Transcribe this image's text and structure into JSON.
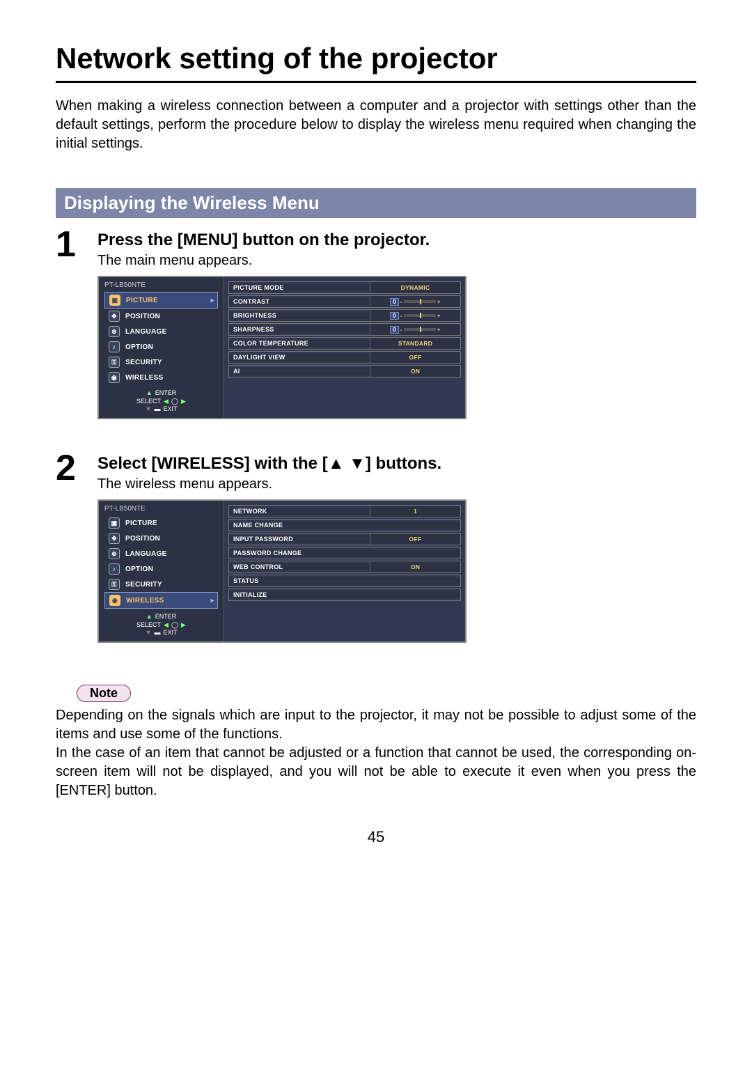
{
  "title": "Network setting of the projector",
  "intro": "When making a wireless connection between a computer and a projector with settings other than the default settings, perform the procedure below to display the wireless menu required when changing the initial settings.",
  "section_heading": "Displaying the Wireless Menu",
  "steps": [
    {
      "num": "1",
      "title": "Press the [MENU] button on the projector.",
      "desc": "The main menu appears."
    },
    {
      "num": "2",
      "title": "Select [WIRELESS] with the [▲ ▼] buttons.",
      "desc": "The wireless menu appears."
    }
  ],
  "osd": {
    "model": "PT-LB50NTE",
    "left_items": [
      "PICTURE",
      "POSITION",
      "LANGUAGE",
      "OPTION",
      "SECURITY",
      "WIRELESS"
    ],
    "controls": {
      "select": "SELECT",
      "enter": "ENTER",
      "exit": "EXIT"
    }
  },
  "osd1": {
    "selected": "PICTURE",
    "rows": [
      {
        "label": "PICTURE MODE",
        "value": "DYNAMIC",
        "type": "text"
      },
      {
        "label": "CONTRAST",
        "value": "0",
        "type": "slider"
      },
      {
        "label": "BRIGHTNESS",
        "value": "0",
        "type": "slider"
      },
      {
        "label": "SHARPNESS",
        "value": "0",
        "type": "slider"
      },
      {
        "label": "COLOR TEMPERATURE",
        "value": "STANDARD",
        "type": "text"
      },
      {
        "label": "DAYLIGHT VIEW",
        "value": "OFF",
        "type": "text"
      },
      {
        "label": "AI",
        "value": "ON",
        "type": "text"
      }
    ]
  },
  "osd2": {
    "selected": "WIRELESS",
    "rows": [
      {
        "label": "NETWORK",
        "value": "1",
        "type": "text"
      },
      {
        "label": "NAME CHANGE",
        "value": "",
        "type": "single"
      },
      {
        "label": "INPUT PASSWORD",
        "value": "OFF",
        "type": "text"
      },
      {
        "label": "PASSWORD CHANGE",
        "value": "",
        "type": "single"
      },
      {
        "label": "WEB CONTROL",
        "value": "ON",
        "type": "text"
      },
      {
        "label": "STATUS",
        "value": "",
        "type": "single"
      },
      {
        "label": "INITIALIZE",
        "value": "",
        "type": "single"
      }
    ]
  },
  "note": {
    "label": "Note",
    "text1": "Depending on the signals which are input to the projector, it may not be possible to adjust some of the items and use some of the functions.",
    "text2": "In the case of an item that cannot be adjusted or a function that cannot be used, the corresponding on-screen item will not be displayed, and you will not be able to execute it even when you press the [ENTER] button."
  },
  "page_number": "45"
}
